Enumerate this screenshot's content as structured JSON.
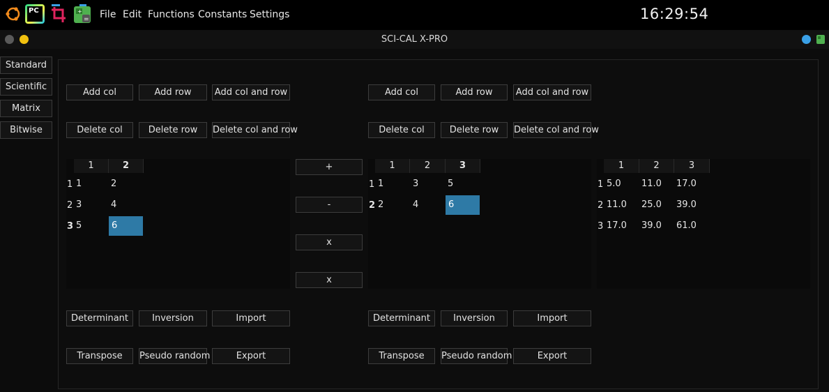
{
  "topbar": {
    "icons": [
      "ubuntu-logo-icon",
      "pycharm-icon",
      "crop-tool-icon",
      "calculator-app-icon"
    ],
    "pycharm_label": "PC",
    "menu": [
      "File",
      "Edit",
      "Functions",
      "Constants",
      "Settings"
    ],
    "clock": "16:29:54"
  },
  "window": {
    "title": "SCI-CAL X-PRO"
  },
  "modes": [
    "Standard",
    "Scientific",
    "Matrix",
    "Bitwise"
  ],
  "left_matrix": {
    "add_col": "Add col",
    "add_row": "Add row",
    "add_col_row": "Add col and row",
    "delete_col": "Delete col",
    "delete_row": "Delete row",
    "delete_col_row": "Delete col and row",
    "col_headers": [
      "1",
      "2"
    ],
    "row_headers": [
      "1",
      "2",
      "3"
    ],
    "rows": [
      [
        "1",
        "2"
      ],
      [
        "3",
        "4"
      ],
      [
        "5",
        "6"
      ]
    ],
    "selected_cell": "row 3, col 2",
    "determinant": "Determinant",
    "inversion": "Inversion",
    "import": "Import",
    "transpose": "Transpose",
    "pseudo_random": "Pseudo random",
    "export": "Export"
  },
  "operations": [
    "+",
    "-",
    "x",
    "x"
  ],
  "right_matrix": {
    "add_col": "Add col",
    "add_row": "Add row",
    "add_col_row": "Add col and row",
    "delete_col": "Delete col",
    "delete_row": "Delete row",
    "delete_col_row": "Delete col and row",
    "col_headers": [
      "1",
      "2",
      "3"
    ],
    "row_headers": [
      "1",
      "2"
    ],
    "rows": [
      [
        "1",
        "3",
        "5"
      ],
      [
        "2",
        "4",
        "6"
      ]
    ],
    "selected_cell": "row 2, col 3",
    "determinant": "Determinant",
    "inversion": "Inversion",
    "import": "Import",
    "transpose": "Transpose",
    "pseudo_random": "Pseudo random",
    "export": "Export"
  },
  "result_matrix": {
    "col_headers": [
      "1",
      "2",
      "3"
    ],
    "row_headers": [
      "1",
      "2",
      "3"
    ],
    "rows": [
      [
        "5.0",
        "11.0",
        "17.0"
      ],
      [
        "11.0",
        "25.0",
        "39.0"
      ],
      [
        "17.0",
        "39.0",
        "61.0"
      ]
    ]
  },
  "colors": {
    "selection": "#2e7aa6",
    "close_button": "#5a5a5a",
    "minimize_button": "#f2c10f",
    "tray_dot": "#3aa0e6",
    "accent_green": "#4fb04f"
  }
}
